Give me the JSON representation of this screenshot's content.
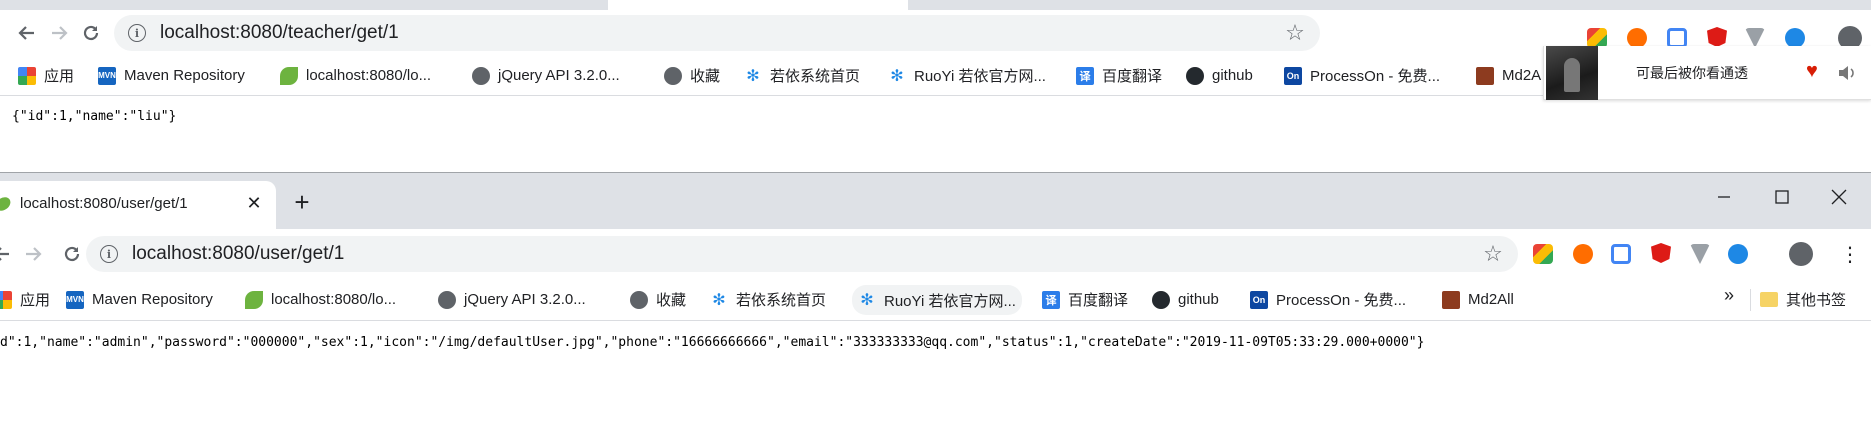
{
  "window1": {
    "url": "localhost:8080/teacher/get/1",
    "json_body": "{\"id\":1,\"name\":\"liu\"}",
    "bookmarks": [
      {
        "label": "应用"
      },
      {
        "label": "Maven Repository"
      },
      {
        "label": "localhost:8080/lo..."
      },
      {
        "label": "jQuery API 3.2.0..."
      },
      {
        "label": "收藏"
      },
      {
        "label": "若依系统首页"
      },
      {
        "label": "RuoYi 若依官方网..."
      },
      {
        "label": "百度翻译"
      },
      {
        "label": "github"
      },
      {
        "label": "ProcessOn - 免费..."
      },
      {
        "label": "Md2A"
      }
    ]
  },
  "music_popup": {
    "song_title": "可最后被你看通透"
  },
  "window2": {
    "tab_title": "localhost:8080/user/get/1",
    "url": "localhost:8080/user/get/1",
    "json_body": "d\":1,\"name\":\"admin\",\"password\":\"000000\",\"sex\":1,\"icon\":\"/img/defaultUser.jpg\",\"phone\":\"16666666666\",\"email\":\"333333333@qq.com\",\"status\":1,\"createDate\":\"2019-11-09T05:33:29.000+0000\"}",
    "bookmarks": [
      {
        "label": "应用"
      },
      {
        "label": "Maven Repository"
      },
      {
        "label": "localhost:8080/lo..."
      },
      {
        "label": "jQuery API 3.2.0..."
      },
      {
        "label": "收藏"
      },
      {
        "label": "若依系统首页"
      },
      {
        "label": "RuoYi 若依官方网..."
      },
      {
        "label": "百度翻译"
      },
      {
        "label": "github"
      },
      {
        "label": "ProcessOn - 免费..."
      },
      {
        "label": "Md2All"
      }
    ],
    "overflow_label": "»",
    "other_bookmarks": "其他书签"
  },
  "icons": {
    "back": "arrow-left-icon",
    "forward": "arrow-right-icon",
    "reload": "reload-icon",
    "info": "info-icon",
    "star": "star-icon",
    "close": "close-icon",
    "new_tab": "plus-icon",
    "menu": "kebab-menu-icon",
    "profile": "profile-icon",
    "heart": "heart-icon",
    "volume": "volume-icon"
  },
  "colors": {
    "tabstrip": "#dee1e6",
    "omnibox": "#f1f3f4",
    "heart": "#d81e06",
    "leaf_green": "#6db33f"
  }
}
